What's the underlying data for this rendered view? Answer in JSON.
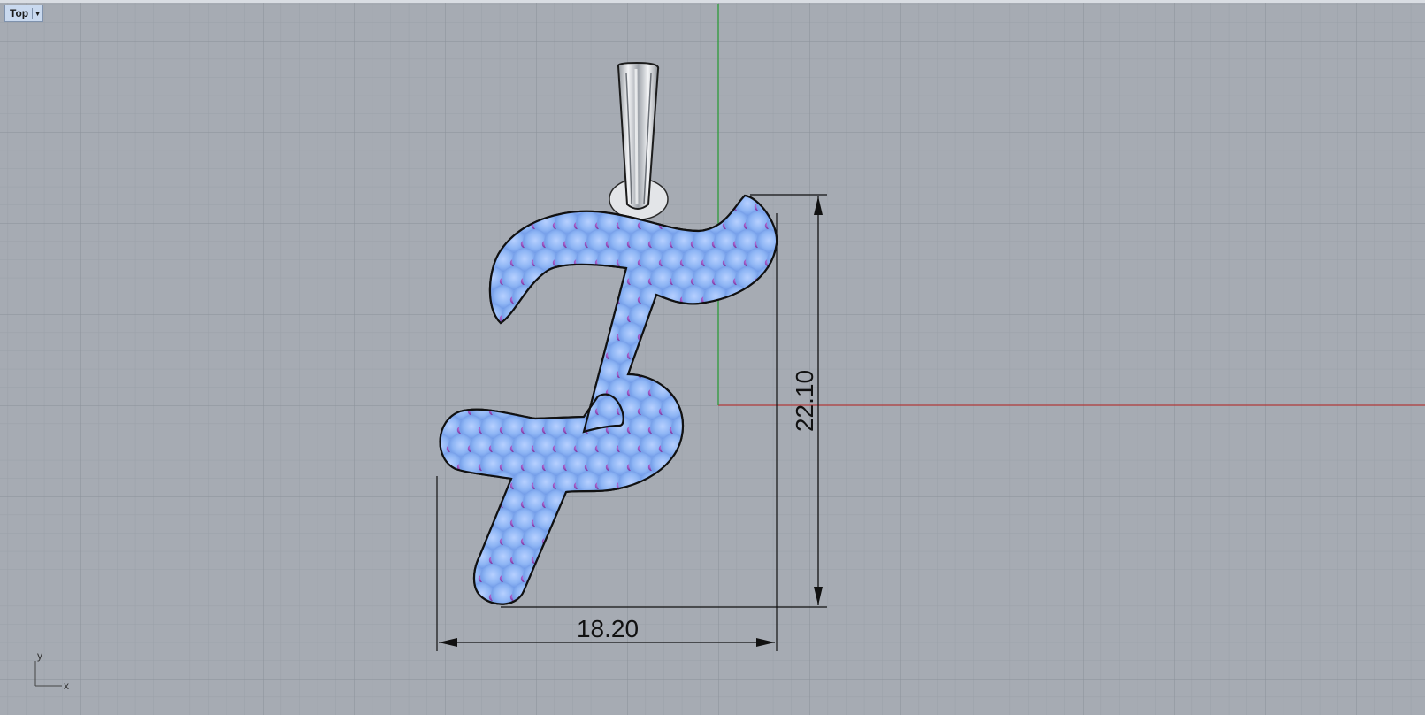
{
  "viewport": {
    "name": "Top",
    "menu_icon": "triangle-down-icon"
  },
  "axes_widget": {
    "y_label": "y",
    "x_label": "x"
  },
  "dimensions": {
    "width_label": "18.20",
    "height_label": "22.10"
  },
  "colors": {
    "background": "#a6abb3",
    "grid_minor": "#9aa0a8",
    "grid_major": "#8a9099",
    "x_axis": "#b03a3a",
    "y_axis": "#2d9b3a",
    "metal": "#f1f2f4",
    "gem_blue": "#8fb6f5",
    "gem_purple": "#8a3fb0"
  }
}
